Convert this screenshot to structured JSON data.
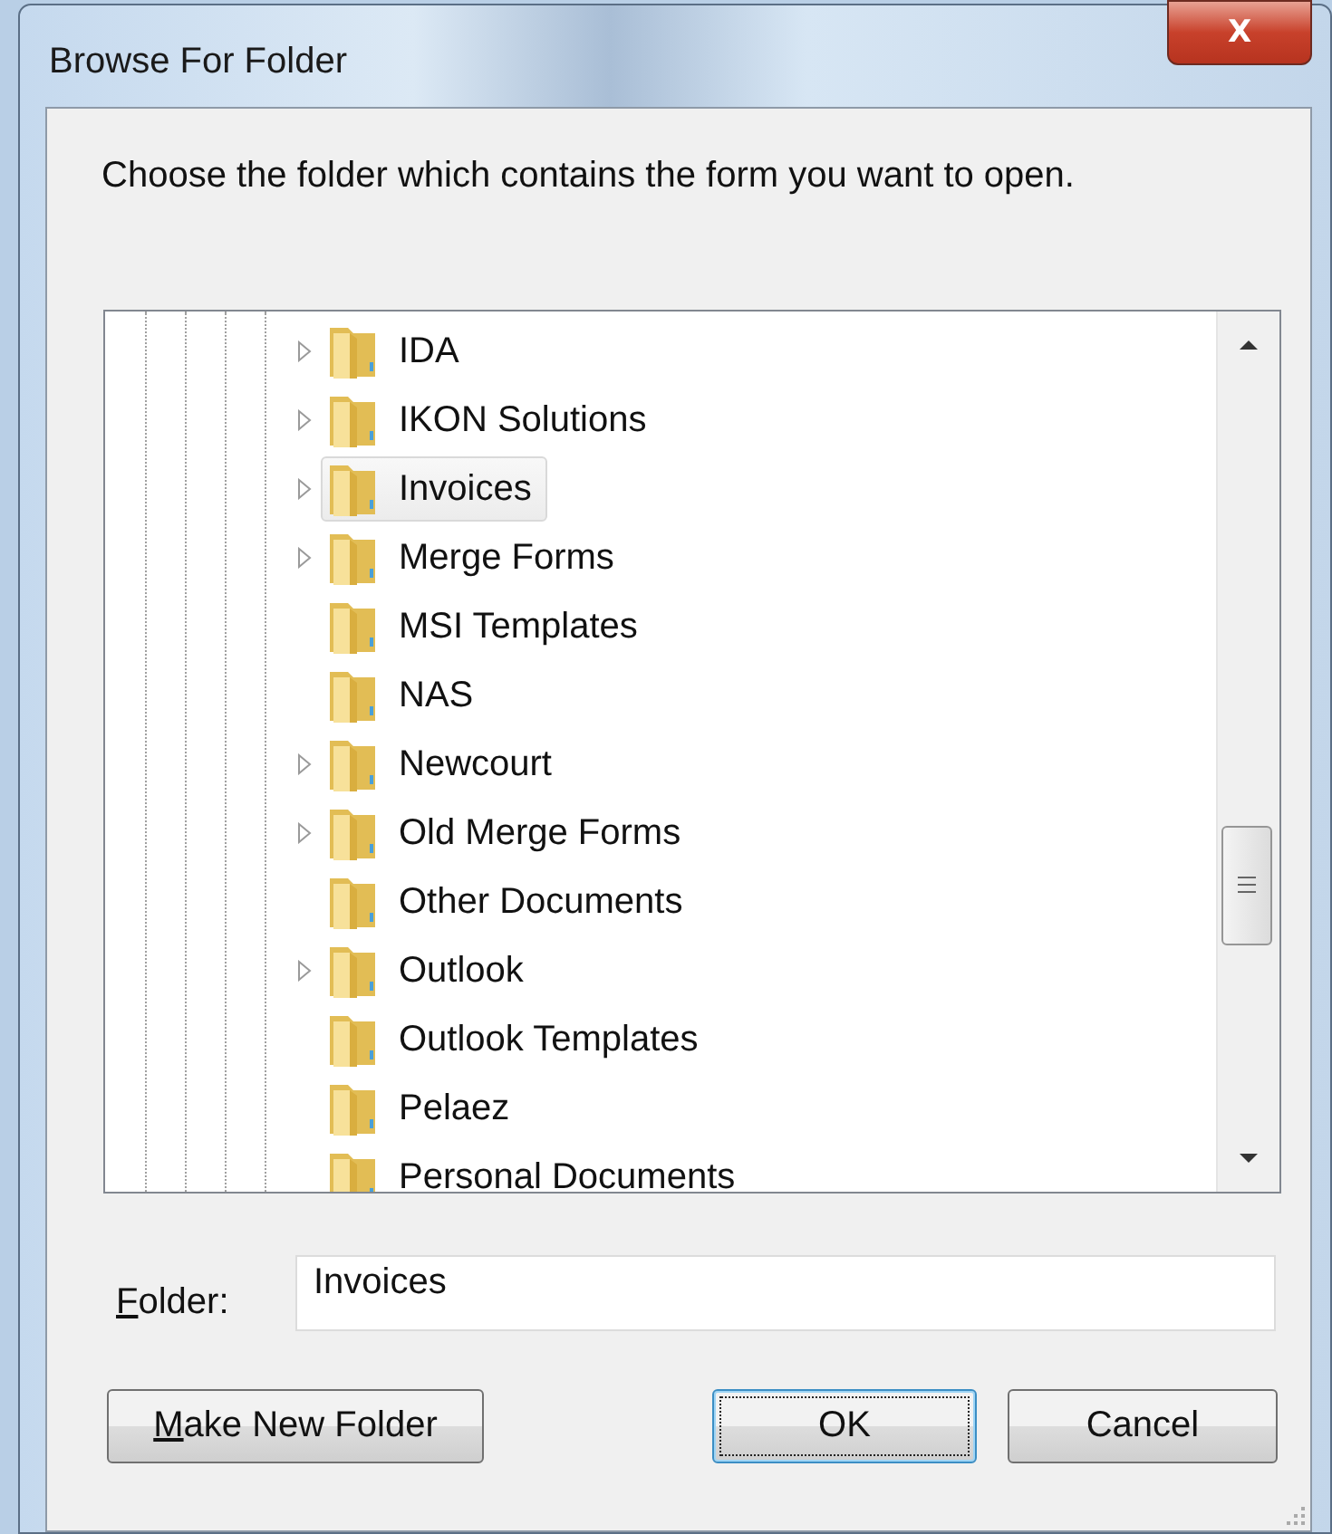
{
  "window": {
    "title": "Browse For Folder",
    "close": "X"
  },
  "instruction": "Choose the folder which contains the form you want to open.",
  "tree": {
    "items": [
      {
        "label": "IDA",
        "expandable": true,
        "selected": false
      },
      {
        "label": "IKON Solutions",
        "expandable": true,
        "selected": false
      },
      {
        "label": "Invoices",
        "expandable": true,
        "selected": true
      },
      {
        "label": "Merge Forms",
        "expandable": true,
        "selected": false
      },
      {
        "label": "MSI Templates",
        "expandable": false,
        "selected": false
      },
      {
        "label": "NAS",
        "expandable": false,
        "selected": false
      },
      {
        "label": "Newcourt",
        "expandable": true,
        "selected": false
      },
      {
        "label": "Old Merge Forms",
        "expandable": true,
        "selected": false
      },
      {
        "label": "Other Documents",
        "expandable": false,
        "selected": false
      },
      {
        "label": "Outlook",
        "expandable": true,
        "selected": false
      },
      {
        "label": "Outlook Templates",
        "expandable": false,
        "selected": false
      },
      {
        "label": "Pelaez",
        "expandable": false,
        "selected": false
      },
      {
        "label": "Personal Documents",
        "expandable": false,
        "selected": false
      }
    ]
  },
  "folder_field": {
    "label": "Folder:",
    "underline_first": true,
    "value": "Invoices"
  },
  "buttons": [
    {
      "label": "Make New Folder",
      "underline_first": true,
      "default": false
    },
    {
      "label": "OK",
      "default": true
    },
    {
      "label": "Cancel",
      "default": false
    }
  ]
}
